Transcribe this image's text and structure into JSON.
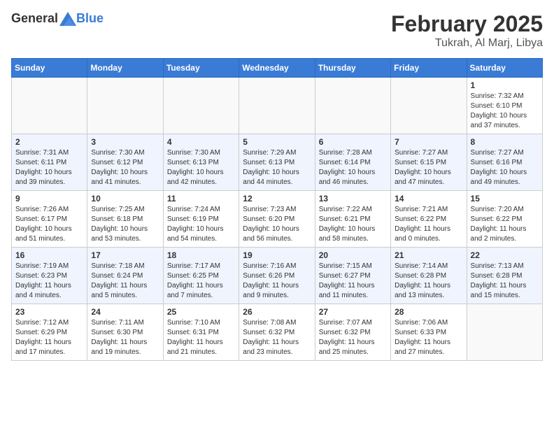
{
  "header": {
    "logo_general": "General",
    "logo_blue": "Blue",
    "month": "February 2025",
    "location": "Tukrah, Al Marj, Libya"
  },
  "weekdays": [
    "Sunday",
    "Monday",
    "Tuesday",
    "Wednesday",
    "Thursday",
    "Friday",
    "Saturday"
  ],
  "weeks": [
    [
      {
        "day": "",
        "info": ""
      },
      {
        "day": "",
        "info": ""
      },
      {
        "day": "",
        "info": ""
      },
      {
        "day": "",
        "info": ""
      },
      {
        "day": "",
        "info": ""
      },
      {
        "day": "",
        "info": ""
      },
      {
        "day": "1",
        "info": "Sunrise: 7:32 AM\nSunset: 6:10 PM\nDaylight: 10 hours\nand 37 minutes."
      }
    ],
    [
      {
        "day": "2",
        "info": "Sunrise: 7:31 AM\nSunset: 6:11 PM\nDaylight: 10 hours\nand 39 minutes."
      },
      {
        "day": "3",
        "info": "Sunrise: 7:30 AM\nSunset: 6:12 PM\nDaylight: 10 hours\nand 41 minutes."
      },
      {
        "day": "4",
        "info": "Sunrise: 7:30 AM\nSunset: 6:13 PM\nDaylight: 10 hours\nand 42 minutes."
      },
      {
        "day": "5",
        "info": "Sunrise: 7:29 AM\nSunset: 6:13 PM\nDaylight: 10 hours\nand 44 minutes."
      },
      {
        "day": "6",
        "info": "Sunrise: 7:28 AM\nSunset: 6:14 PM\nDaylight: 10 hours\nand 46 minutes."
      },
      {
        "day": "7",
        "info": "Sunrise: 7:27 AM\nSunset: 6:15 PM\nDaylight: 10 hours\nand 47 minutes."
      },
      {
        "day": "8",
        "info": "Sunrise: 7:27 AM\nSunset: 6:16 PM\nDaylight: 10 hours\nand 49 minutes."
      }
    ],
    [
      {
        "day": "9",
        "info": "Sunrise: 7:26 AM\nSunset: 6:17 PM\nDaylight: 10 hours\nand 51 minutes."
      },
      {
        "day": "10",
        "info": "Sunrise: 7:25 AM\nSunset: 6:18 PM\nDaylight: 10 hours\nand 53 minutes."
      },
      {
        "day": "11",
        "info": "Sunrise: 7:24 AM\nSunset: 6:19 PM\nDaylight: 10 hours\nand 54 minutes."
      },
      {
        "day": "12",
        "info": "Sunrise: 7:23 AM\nSunset: 6:20 PM\nDaylight: 10 hours\nand 56 minutes."
      },
      {
        "day": "13",
        "info": "Sunrise: 7:22 AM\nSunset: 6:21 PM\nDaylight: 10 hours\nand 58 minutes."
      },
      {
        "day": "14",
        "info": "Sunrise: 7:21 AM\nSunset: 6:22 PM\nDaylight: 11 hours\nand 0 minutes."
      },
      {
        "day": "15",
        "info": "Sunrise: 7:20 AM\nSunset: 6:22 PM\nDaylight: 11 hours\nand 2 minutes."
      }
    ],
    [
      {
        "day": "16",
        "info": "Sunrise: 7:19 AM\nSunset: 6:23 PM\nDaylight: 11 hours\nand 4 minutes."
      },
      {
        "day": "17",
        "info": "Sunrise: 7:18 AM\nSunset: 6:24 PM\nDaylight: 11 hours\nand 5 minutes."
      },
      {
        "day": "18",
        "info": "Sunrise: 7:17 AM\nSunset: 6:25 PM\nDaylight: 11 hours\nand 7 minutes."
      },
      {
        "day": "19",
        "info": "Sunrise: 7:16 AM\nSunset: 6:26 PM\nDaylight: 11 hours\nand 9 minutes."
      },
      {
        "day": "20",
        "info": "Sunrise: 7:15 AM\nSunset: 6:27 PM\nDaylight: 11 hours\nand 11 minutes."
      },
      {
        "day": "21",
        "info": "Sunrise: 7:14 AM\nSunset: 6:28 PM\nDaylight: 11 hours\nand 13 minutes."
      },
      {
        "day": "22",
        "info": "Sunrise: 7:13 AM\nSunset: 6:28 PM\nDaylight: 11 hours\nand 15 minutes."
      }
    ],
    [
      {
        "day": "23",
        "info": "Sunrise: 7:12 AM\nSunset: 6:29 PM\nDaylight: 11 hours\nand 17 minutes."
      },
      {
        "day": "24",
        "info": "Sunrise: 7:11 AM\nSunset: 6:30 PM\nDaylight: 11 hours\nand 19 minutes."
      },
      {
        "day": "25",
        "info": "Sunrise: 7:10 AM\nSunset: 6:31 PM\nDaylight: 11 hours\nand 21 minutes."
      },
      {
        "day": "26",
        "info": "Sunrise: 7:08 AM\nSunset: 6:32 PM\nDaylight: 11 hours\nand 23 minutes."
      },
      {
        "day": "27",
        "info": "Sunrise: 7:07 AM\nSunset: 6:32 PM\nDaylight: 11 hours\nand 25 minutes."
      },
      {
        "day": "28",
        "info": "Sunrise: 7:06 AM\nSunset: 6:33 PM\nDaylight: 11 hours\nand 27 minutes."
      },
      {
        "day": "",
        "info": ""
      }
    ]
  ]
}
